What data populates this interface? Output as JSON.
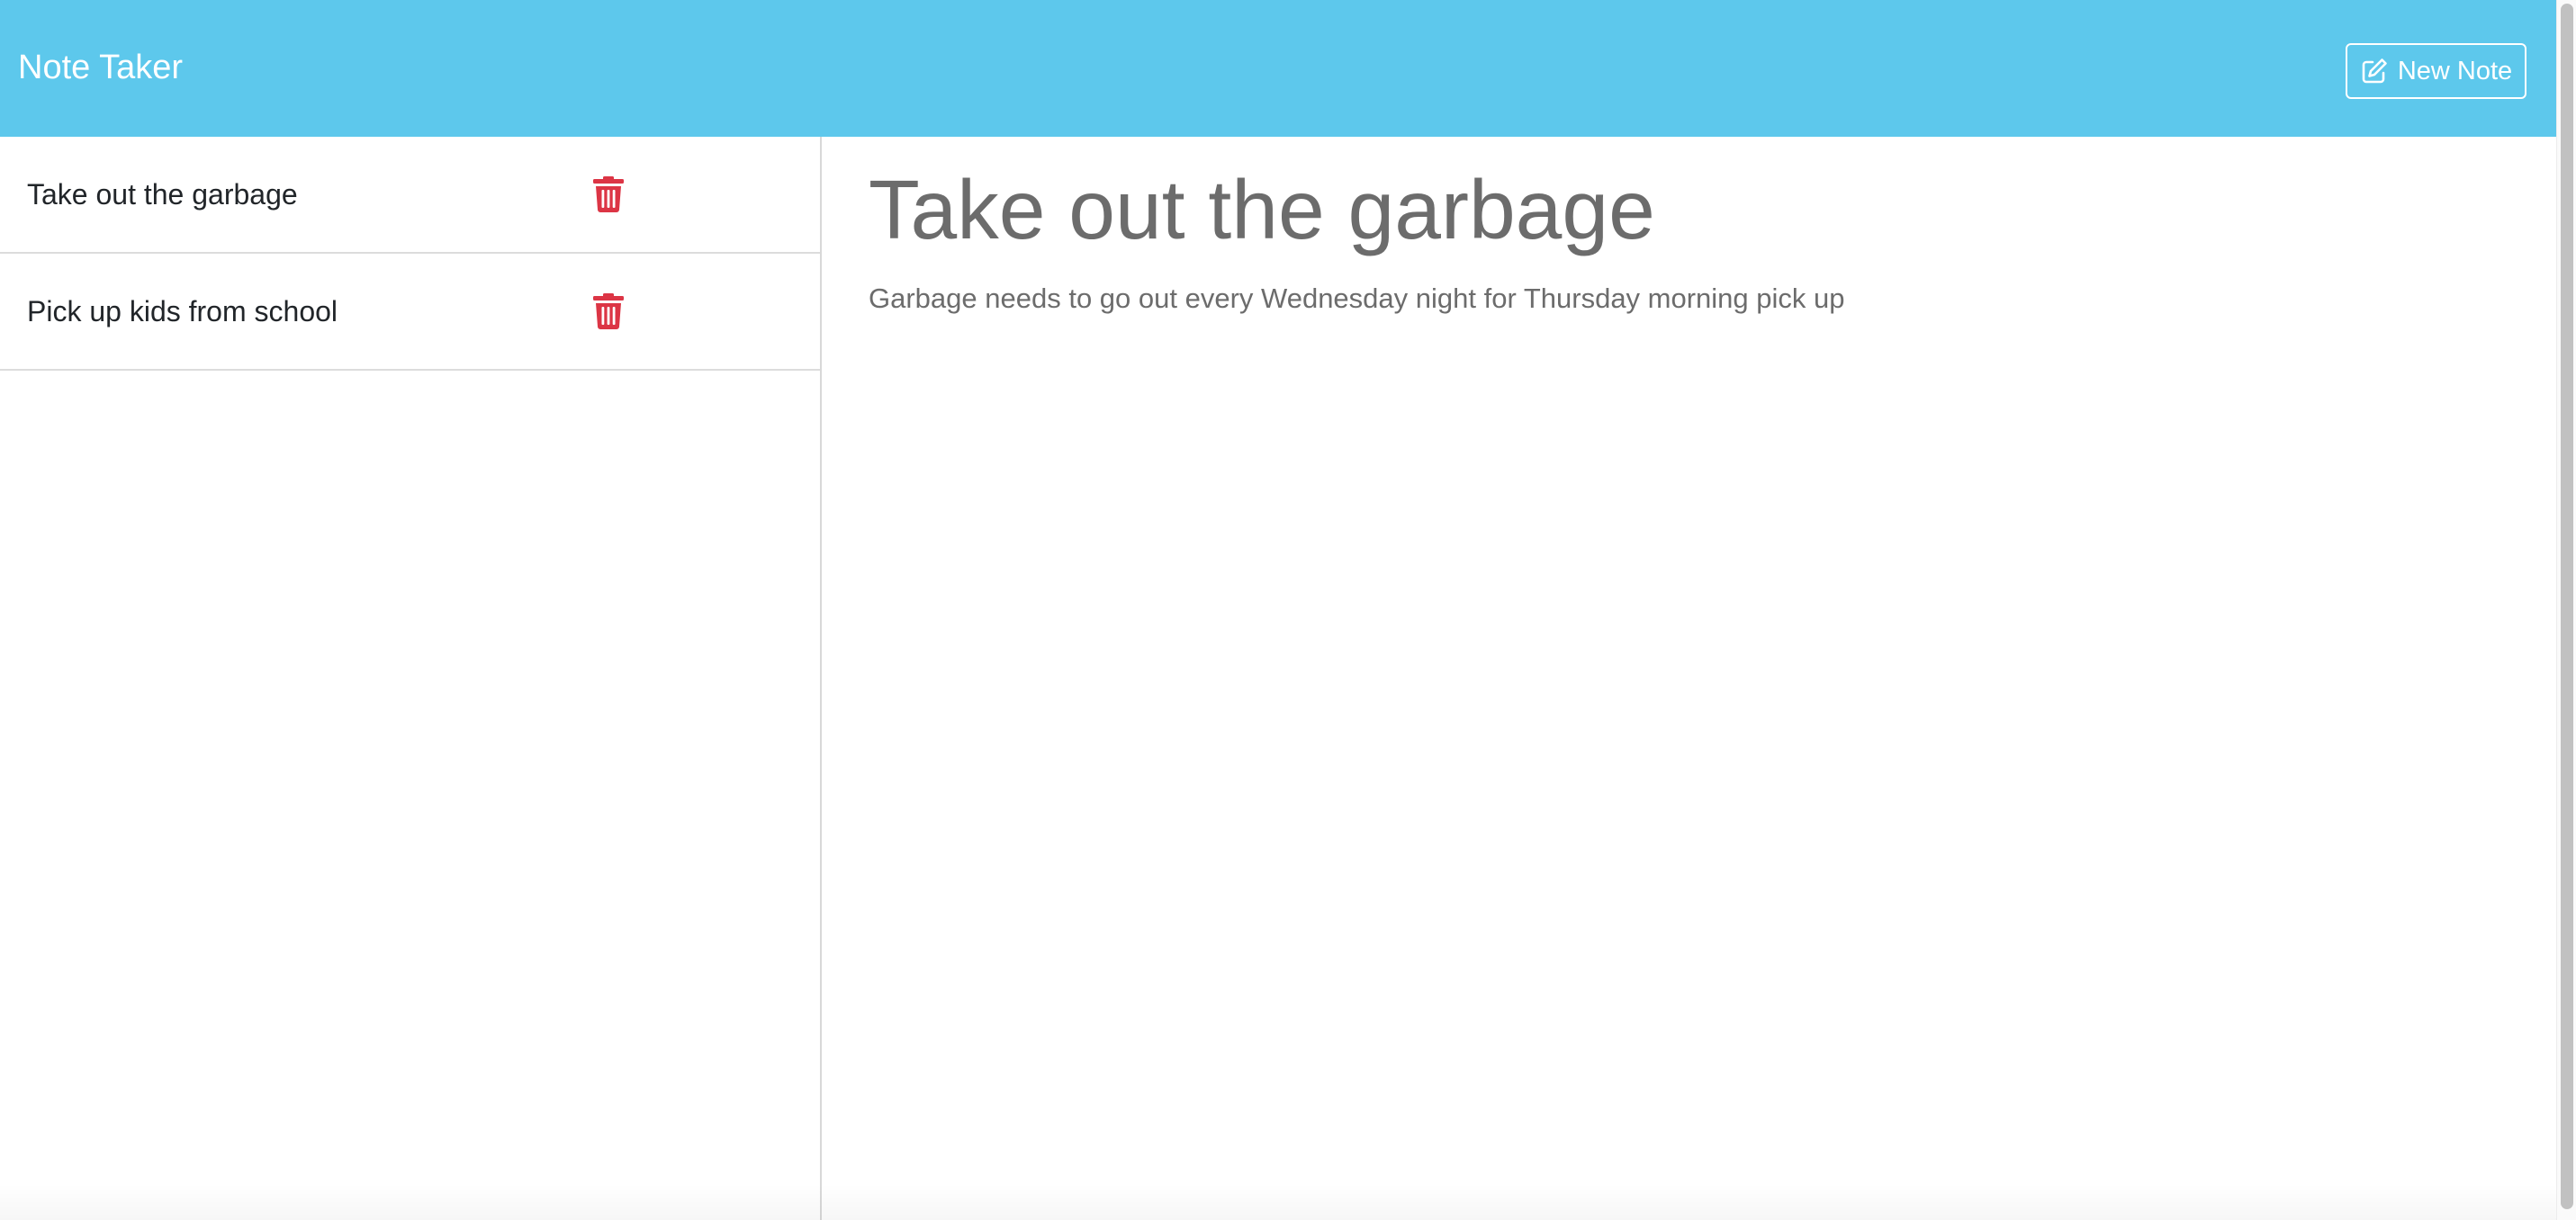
{
  "app": {
    "brand": "Note Taker",
    "new_note_label": "New Note",
    "new_note_icon": "pen-to-square-icon",
    "delete_icon": "trash-icon",
    "accent_color": "#5dc8ec",
    "delete_color": "#dc3545"
  },
  "notes": [
    {
      "title": "Take out the garbage"
    },
    {
      "title": "Pick up kids from school"
    }
  ],
  "active_note": {
    "title": "Take out the garbage",
    "text": "Garbage needs to go out every Wednesday night for Thursday morning pick up"
  }
}
